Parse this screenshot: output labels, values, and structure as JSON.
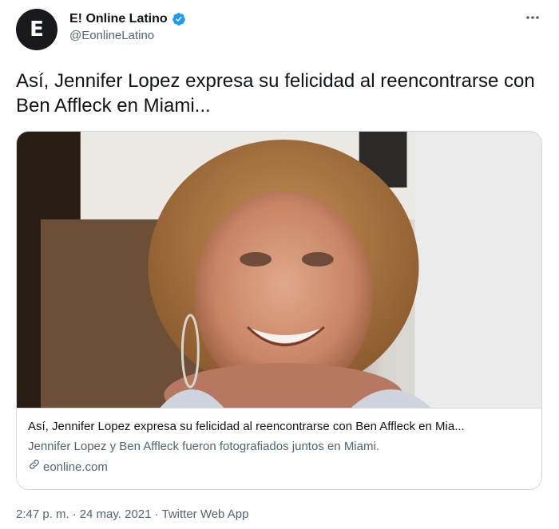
{
  "author": {
    "display_name": "E! Online Latino",
    "handle": "@EonlineLatino",
    "avatar_letter": "E"
  },
  "tweet": {
    "text": "Así, Jennifer Lopez expresa su felicidad al reencontrarse con Ben Affleck en Miami..."
  },
  "card": {
    "title": "Así, Jennifer Lopez expresa su felicidad al reencontrarse con Ben Affleck en Mia...",
    "description": "Jennifer Lopez y Ben Affleck fueron fotografiados juntos en Miami.",
    "domain": "eonline.com"
  },
  "meta": {
    "time": "2:47 p. m.",
    "separator": "·",
    "date": "24 may. 2021",
    "source": "Twitter Web App"
  },
  "colors": {
    "text_primary": "#0f1419",
    "text_secondary": "#536471",
    "verified_blue": "#1d9bf0",
    "border": "#cfd9de"
  },
  "icons": [
    "verified-badge-icon",
    "more-options-icon",
    "link-icon"
  ]
}
